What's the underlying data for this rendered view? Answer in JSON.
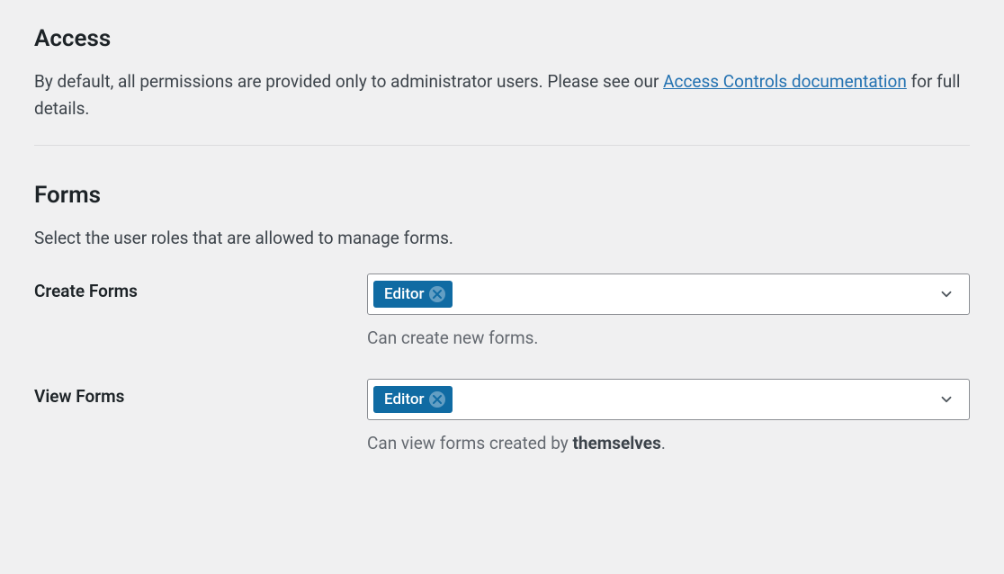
{
  "access": {
    "heading": "Access",
    "desc_prefix": "By default, all permissions are provided only to administrator users. Please see our ",
    "link_text": "Access Controls documentation",
    "desc_suffix": " for full details."
  },
  "forms": {
    "heading": "Forms",
    "desc": "Select the user roles that are allowed to manage forms.",
    "rows": [
      {
        "label": "Create Forms",
        "tag": "Editor",
        "help_prefix": "Can create new forms.",
        "help_bold": "",
        "help_suffix": ""
      },
      {
        "label": "View Forms",
        "tag": "Editor",
        "help_prefix": "Can view forms created by ",
        "help_bold": "themselves",
        "help_suffix": "."
      }
    ]
  }
}
